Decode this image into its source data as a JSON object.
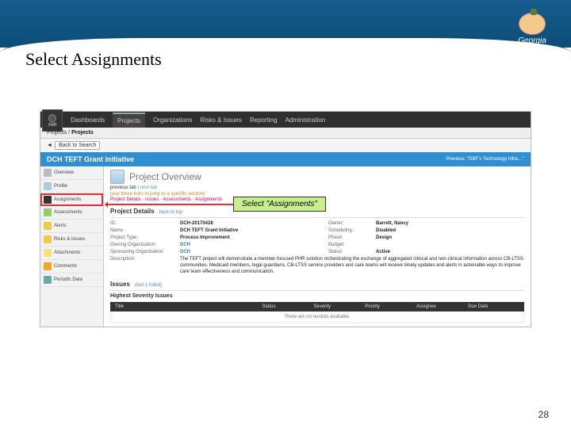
{
  "slide": {
    "title": "Select Assignments",
    "page": "28",
    "logo": "Georgia"
  },
  "callout": {
    "text": "Select \"Assignments\""
  },
  "app": {
    "brand": "AMI",
    "nav": {
      "dashboards": "Dashboards",
      "projects": "Projects",
      "organizations": "Organizations",
      "risks": "Risks & Issues",
      "reporting": "Reporting",
      "admin": "Administration"
    },
    "crumb": {
      "root": "Projects",
      "leaf": "Projects"
    },
    "back": "Back to Search",
    "bluebar": {
      "title": "DCH TEFT Grant Initiative",
      "prev": "Previous: \"DBF's Technology Infra…\""
    },
    "sidebar": {
      "overview": "Overview",
      "profile": "Profile",
      "assignments": "Assignments",
      "assessments": "Assessments",
      "alerts": "Alerts",
      "risks": "Risks & Issues",
      "attachments": "Attachments",
      "comments": "Comments",
      "periodic": "Periodic Data"
    },
    "po": {
      "title": "Project Overview",
      "tab_prev": "previous tab",
      "tab_next": "next tab",
      "hint": "(use these links to jump to a specific section)",
      "links": "Project Details · Issues · Assessments · Assignments",
      "details_hd": "Project Details",
      "back_top": "back to top",
      "fields": {
        "id_l": "ID:",
        "id_v": "DCH-20170428",
        "name_l": "Name:",
        "name_v": "DCH TEFT Grant Initiative",
        "ptype_l": "Project Type:",
        "ptype_v": "Process Improvement",
        "own_l": "Owning Organization:",
        "own_v": "DCH",
        "spon_l": "Sponsoring Organization:",
        "spon_v": "DCH",
        "desc_l": "Description:",
        "desc_v": "The TEFT project will demonstrate a member-focused PHR solution orchestrating the exchange of aggregated clinical and non-clinical information across CB-LTSS communities. Medicaid members, legal guardians, CB-LTSS service providers and care teams will receive timely updates and alerts in actionable ways to improve care team effectiveness and communication.",
        "owner_l": "Owner:",
        "owner_v": "Barrett, Nancy",
        "sched_l": "Scheduling:",
        "sched_v": "Disabled",
        "phase_l": "Phase:",
        "phase_v": "Design",
        "budget_l": "Budget:",
        "budget_v": "",
        "status_l": "Status:",
        "status_v": "Active"
      },
      "issues_hd": "Issues",
      "issues_link": "(last 1 listed)",
      "hs_hd": "Highest Severity Issues",
      "cols": {
        "title": "Title",
        "status": "Status",
        "severity": "Severity",
        "priority": "Priority",
        "assignee": "Assignee",
        "due": "Due Date"
      },
      "norec": "There are no records available."
    }
  }
}
